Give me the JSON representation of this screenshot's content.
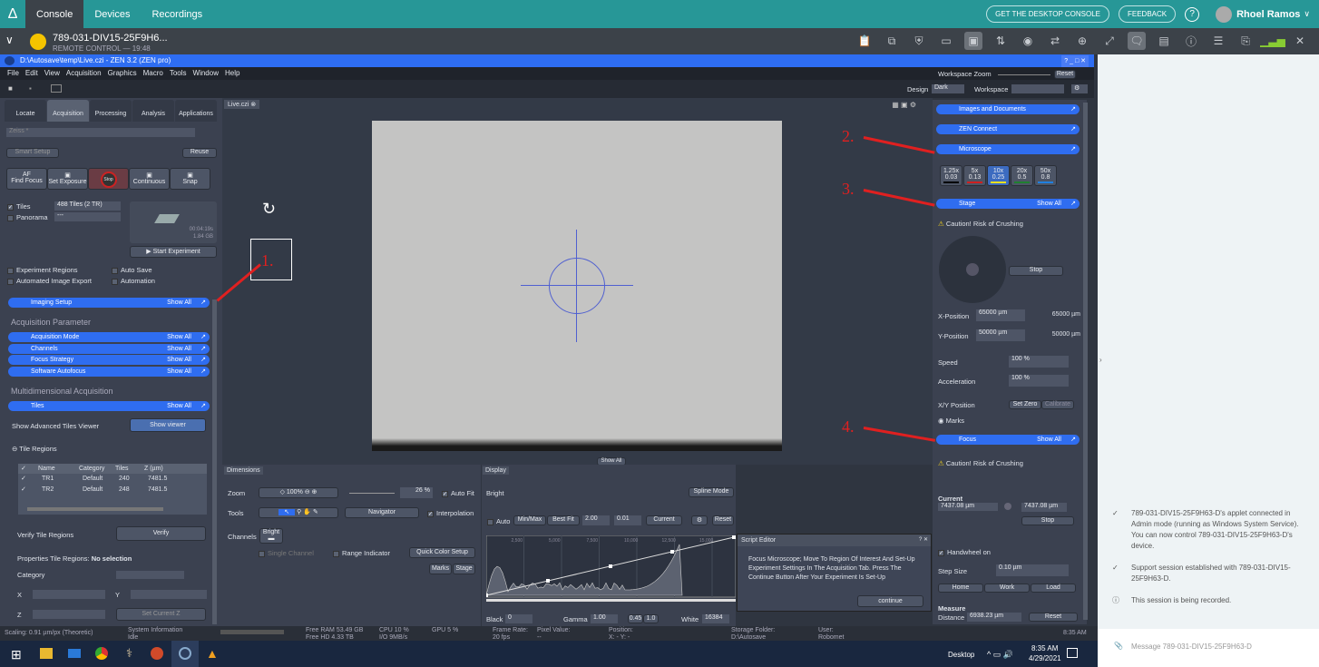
{
  "topbar": {
    "tabs": [
      "Console",
      "Devices",
      "Recordings"
    ],
    "get_desktop": "GET THE DESKTOP CONSOLE",
    "feedback": "FEEDBACK",
    "help_icon": "?",
    "user": "Rhoel Ramos",
    "brand_color": "#279797"
  },
  "session": {
    "name": "789-031-DIV15-25F9H6...",
    "subtitle": "REMOTE CONTROL — 19:48",
    "tools": [
      "clipboard-icon",
      "multi-screen-icon",
      "admin-shield-icon",
      "window-icon",
      "remote-view-icon",
      "file-transfer-icon",
      "screenshot-icon",
      "switch-screen-icon",
      "zoom-icon",
      "fullscreen-icon",
      "chat-icon",
      "files-icon",
      "info-icon",
      "notes-icon",
      "scripts-icon",
      "signal-icon",
      "close-icon"
    ]
  },
  "zen": {
    "title": "D:\\Autosave\\temp\\Live.czi - ZEN 3.2 (ZEN pro)",
    "menu": [
      "File",
      "Edit",
      "View",
      "Acquisition",
      "Graphics",
      "Macro",
      "Tools",
      "Window",
      "Help"
    ],
    "workspace_zoom": "Workspace Zoom",
    "reset": "Reset",
    "design_label": "Design",
    "design_value": "Dark",
    "workspace_label": "Workspace",
    "left": {
      "tabs": [
        "Locate",
        "Acquisition",
        "Processing",
        "Analysis",
        "Applications"
      ],
      "profile": "Zeiss *",
      "smart_setup": "Smart Setup",
      "reuse": "Reuse",
      "actions": [
        "Find Focus",
        "Set Exposure",
        "Stop",
        "Continuous",
        "Snap"
      ],
      "af": "AF",
      "tiles_label": "Tiles",
      "tiles_value": "488 Tiles (2 TR)",
      "panorama_label": "Panorama",
      "panorama_value": "---",
      "preview_time": "00:04:19s",
      "preview_size": "1.84 GB",
      "start_experiment": "Start Experiment",
      "options": [
        "Experiment Regions",
        "Auto Save",
        "Automated Image Export",
        "Automation"
      ],
      "imaging_setup": "Imaging Setup",
      "show_all": "Show All",
      "acq_param": "Acquisition Parameter",
      "acq_sections": [
        "Acquisition Mode",
        "Channels",
        "Focus Strategy",
        "Software Autofocus"
      ],
      "multi": "Multidimensional Acquisition",
      "tiles_section": "Tiles",
      "adv_viewer": "Show Advanced Tiles Viewer",
      "show_viewer": "Show viewer",
      "tile_regions": "Tile Regions",
      "table_headers": [
        "Name",
        "Category",
        "Tiles",
        "Z (µm)"
      ],
      "rows": [
        [
          "TR1",
          "Default",
          "240",
          "7481.5"
        ],
        [
          "TR2",
          "Default",
          "248",
          "7481.5"
        ]
      ],
      "verify_label": "Verify Tile Regions",
      "verify": "Verify",
      "props_label": "Properties Tile Regions:",
      "props_value": "No selection",
      "category": "Category",
      "x": "X",
      "y": "Y",
      "z": "Z",
      "set_current_z": "Set Current Z"
    },
    "doc_tab": "Live.czi",
    "dimensions": {
      "tab": "Dimensions",
      "zoom": "Zoom",
      "zoom_100": "100%",
      "zoom_value": "26 %",
      "auto_fit": "Auto Fit",
      "tools": "Tools",
      "navigator": "Navigator",
      "interpolation": "Interpolation",
      "channels": "Channels",
      "channel_name": "Bright",
      "single_channel": "Single Channel",
      "range_indicator": "Range Indicator",
      "quick_color": "Quick Color Setup",
      "marks": "Marks",
      "stage": "Stage",
      "show_all": "Show All"
    },
    "display": {
      "tab": "Display",
      "channel": "Bright",
      "spline": "Spline Mode",
      "auto": "Auto",
      "minmax": "Min/Max",
      "bestfit": "Best Fit",
      "v1": "2.00",
      "v2": "0.01",
      "current": "Current",
      "reset": "Reset",
      "ticks": [
        "2,500",
        "5,000",
        "7,500",
        "10,000",
        "12,500",
        "15,000"
      ],
      "black": "Black",
      "black_value": "0",
      "gamma": "Gamma",
      "gamma_value": "1.00",
      "g1": "0.45",
      "g2": "1.0",
      "white": "White",
      "white_value": "16384"
    },
    "script_editor": {
      "title": "Script Editor",
      "message": "Focus Microscope; Move To Region Of Interest And Set-Up Experiment Settings In The Acquisition Tab. Press The Continue Button After Your Experiment Is Set-Up",
      "continue": "continue"
    },
    "right": {
      "images_docs": "Images and Documents",
      "zen_connect": "ZEN Connect",
      "microscope": "Microscope",
      "objectives": [
        {
          "mag": "1.25x",
          "na": "0.03",
          "color": "#000000"
        },
        {
          "mag": "5x",
          "na": "0.13",
          "color": "#d02020"
        },
        {
          "mag": "10x",
          "na": "0.25",
          "color": "#e8e020",
          "active": true
        },
        {
          "mag": "20x",
          "na": "0.5",
          "color": "#208030"
        },
        {
          "mag": "50x",
          "na": "0.8",
          "color": "#2080e0"
        }
      ],
      "stage": "Stage",
      "show_all": "Show All",
      "caution": "Caution! Risk of Crushing",
      "stop": "Stop",
      "x_label": "X-Position",
      "x_value": "65000 µm",
      "x_readout": "65000 µm",
      "y_label": "Y-Position",
      "y_value": "50000 µm",
      "y_readout": "50000 µm",
      "speed": "Speed",
      "speed_value": "100 %",
      "accel": "Acceleration",
      "accel_value": "100 %",
      "xy_label": "X/Y Position",
      "set_zero": "Set Zero",
      "calibrate": "Calibrate",
      "marks": "Marks",
      "focus": "Focus",
      "current": "Current",
      "current_value": "7437.08 µm",
      "target_value": "7437.08 µm",
      "handwheel": "Handwheel on",
      "step_size": "Step Size",
      "step_value": "0.10 µm",
      "home": "Home",
      "work": "Work",
      "load": "Load",
      "measure": "Measure",
      "distance": "Distance",
      "distance_value": "6938.23 µm",
      "reset": "Reset"
    },
    "status": {
      "scaling": "Scaling: 0.91 µm/px (Theoretic)",
      "sysinfo": "System Information",
      "idle": "Idle",
      "ram": "Free RAM 53.49 GB",
      "hd": "Free HD   4.33 TB",
      "cpu": "CPU 10 %",
      "io": "I/O  9MB/s",
      "gpu": "GPU 5 %",
      "framerate": "Frame Rate:",
      "fps": "20 fps",
      "pixel": "Pixel Value:",
      "pixel_v": "--",
      "position": "Position:",
      "pos_v": "X: -    Y: -",
      "storage": "Storage Folder:",
      "storage_v": "D:\\Autosave",
      "user": "User:",
      "user_v": "Robomet",
      "time": "8:35 AM"
    }
  },
  "annotations": [
    "1.",
    "2.",
    "3.",
    "4."
  ],
  "taskbar": {
    "desktop": "Desktop",
    "time": "8:35 AM",
    "date": "4/29/2021"
  },
  "chat": {
    "messages": [
      {
        "icon": "check-circle-icon",
        "text": "789-031-DIV15-25F9H63-D's applet connected in Admin mode (running as Windows System Service). You can now control 789-031-DIV15-25F9H63-D's device."
      },
      {
        "icon": "check-circle-icon",
        "text": "Support session established with 789-031-DIV15-25F9H63-D."
      },
      {
        "icon": "alert-circle-icon",
        "text": "This session is being recorded."
      }
    ],
    "placeholder": "Message 789-031-DIV15-25F9H63-D"
  }
}
